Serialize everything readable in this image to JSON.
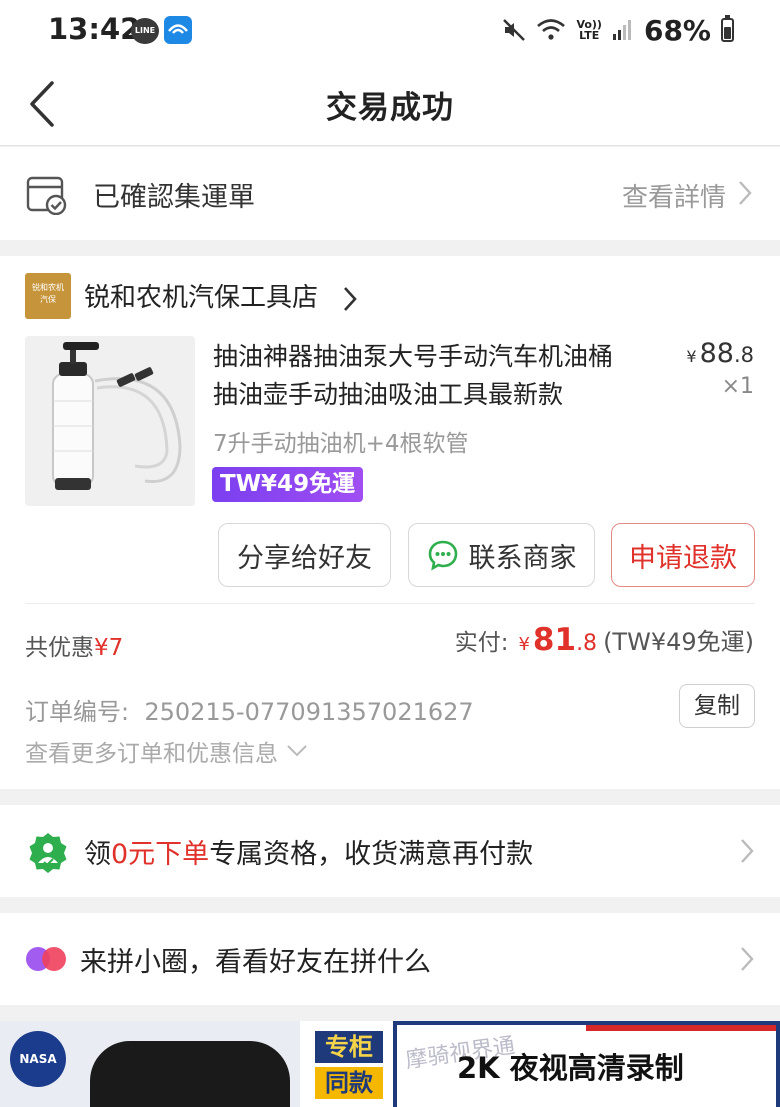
{
  "status_bar": {
    "time": "13:42",
    "line_app": "LINE",
    "volte_top": "Vo))",
    "volte_bottom": "LTE",
    "battery": "68%"
  },
  "nav": {
    "title": "交易成功"
  },
  "logistics": {
    "title": "已確認集運單",
    "link": "查看詳情"
  },
  "shop": {
    "logo_text_line1": "锐和农机",
    "logo_text_line2": "汽保",
    "name": "锐和农机汽保工具店"
  },
  "product": {
    "title_line1": "抽油神器抽油泵大号手动汽车机油桶",
    "title_line2": "抽油壶手动抽油吸油工具最新款",
    "price_symbol": "¥",
    "price_int": "88",
    "price_dec": ".8",
    "quantity": "×1",
    "spec": "7升手动抽油机+4根软管",
    "badge": "TW¥49免運"
  },
  "actions": {
    "share": "分享给好友",
    "contact": "联系商家",
    "refund": "申请退款"
  },
  "summary": {
    "discount_label": "共优惠",
    "discount_value": "¥7",
    "paid_label": "实付:",
    "paid_symbol": "¥",
    "paid_int": "81",
    "paid_dec": ".8",
    "paid_note": "(TW¥49免運)"
  },
  "order_info": {
    "order_no": "订单编号:  250215-077091357021627",
    "copy": "复制",
    "more": "查看更多订单和优惠信息"
  },
  "promo1": {
    "prefix": "领",
    "highlight": "0元下单",
    "suffix": "专属资格，收货满意再付款"
  },
  "promo2": {
    "text": "来拼小圈，看看好友在拼什么"
  },
  "ads": {
    "nasa": "NASA",
    "tag_line1": "专柜",
    "tag_line2": "同款",
    "right_text": "2K 夜视高清录制",
    "watermark": "摩骑视界通"
  },
  "colors": {
    "accent_red": "#e0312a",
    "badge_purple": "#8a45f0",
    "shop_logo": "#c6953b",
    "promo_green": "#2fae4e"
  }
}
